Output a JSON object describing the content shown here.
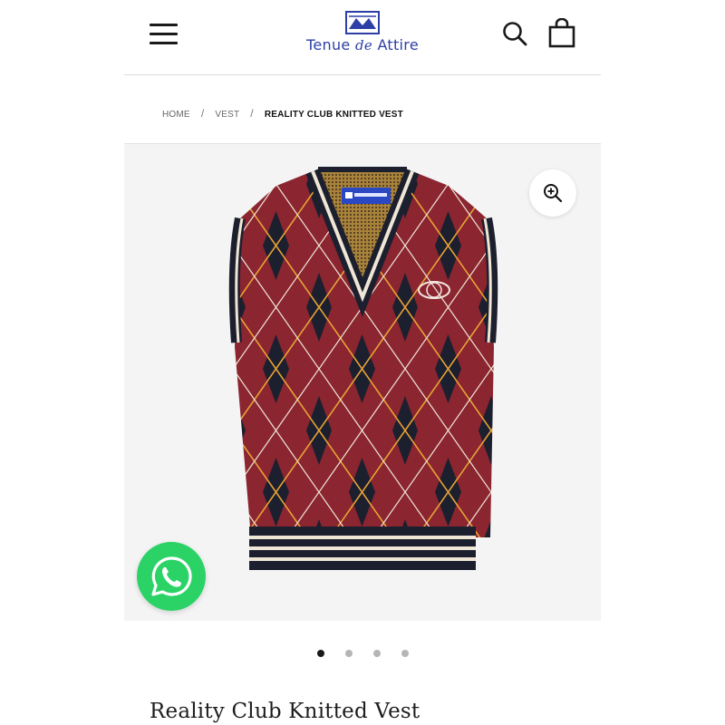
{
  "header": {
    "logo": {
      "brand_main": "Tenue",
      "brand_de": "de",
      "brand_end": "Attire"
    },
    "menu_icon": "hamburger-menu-icon",
    "search_icon": "search-icon",
    "bag_icon": "shopping-bag-icon"
  },
  "breadcrumb": {
    "items": [
      "HOME",
      "VEST",
      "REALITY CLUB KNITTED VEST"
    ],
    "separator": "/"
  },
  "gallery": {
    "image_alt": "Reality Club Knitted Vest",
    "zoom_icon": "zoom-in-icon",
    "total_images": 4,
    "active_index": 0
  },
  "product": {
    "title": "Reality Club Knitted Vest"
  },
  "whatsapp": {
    "icon": "whatsapp-icon"
  },
  "colors": {
    "brand_blue": "#2d3fa6",
    "vest_red": "#8b2530",
    "vest_navy": "#1c1f2e",
    "whatsapp_green": "#2bd366",
    "gallery_bg": "#f4f4f4"
  }
}
